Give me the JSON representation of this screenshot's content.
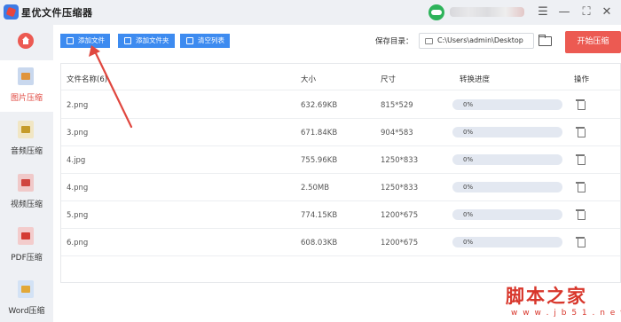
{
  "app": {
    "title": "星优文件压缩器"
  },
  "titlebar": {
    "icons": [
      "user-avatar",
      "settings-icon",
      "minimize-icon",
      "maximize-icon",
      "close-icon"
    ]
  },
  "sidebar": {
    "items": [
      {
        "label": "图片压缩",
        "icon": "image-icon",
        "active": true
      },
      {
        "label": "音频压缩",
        "icon": "audio-icon",
        "active": false
      },
      {
        "label": "视频压缩",
        "icon": "video-icon",
        "active": false
      },
      {
        "label": "PDF压缩",
        "icon": "pdf-icon",
        "active": false
      },
      {
        "label": "Word压缩",
        "icon": "word-icon",
        "active": false
      }
    ]
  },
  "toolbar": {
    "add_file": "添加文件",
    "add_folder": "添加文件夹",
    "clear_list": "清空列表",
    "save_dir_label": "保存目录：",
    "save_dir_value": "C:\\Users\\admin\\Desktop",
    "start": "开始压缩"
  },
  "table": {
    "headers": [
      "文件名称(6)",
      "大小",
      "尺寸",
      "转换进度",
      "操作"
    ],
    "rows": [
      {
        "name": "2.png",
        "size": "632.69KB",
        "dims": "815*529",
        "progress": "0%"
      },
      {
        "name": "3.png",
        "size": "671.84KB",
        "dims": "904*583",
        "progress": "0%"
      },
      {
        "name": "4.jpg",
        "size": "755.96KB",
        "dims": "1250*833",
        "progress": "0%"
      },
      {
        "name": "4.png",
        "size": "2.50MB",
        "dims": "1250*833",
        "progress": "0%"
      },
      {
        "name": "5.png",
        "size": "774.15KB",
        "dims": "1200*675",
        "progress": "0%"
      },
      {
        "name": "6.png",
        "size": "608.03KB",
        "dims": "1200*675",
        "progress": "0%"
      }
    ]
  },
  "watermark": {
    "text": "脚本之家",
    "url": "w w w . j b 5 1 . n e t"
  },
  "colors": {
    "accent": "#3d8bf0",
    "start": "#ec5a52",
    "active_nav": "#e0473f",
    "arrow": "#e0473f",
    "watermark": "#d8362b"
  }
}
